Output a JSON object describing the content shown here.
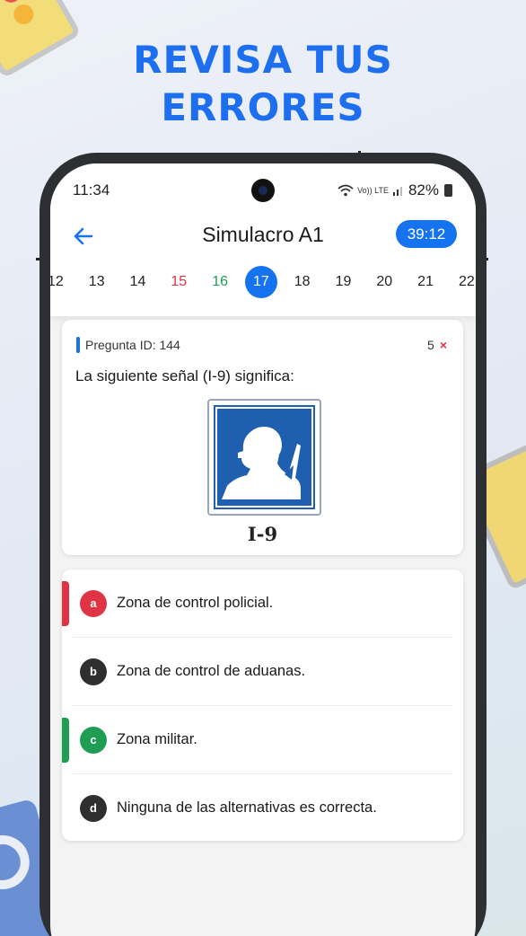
{
  "headline": [
    "REVISA TUS",
    "ERRORES"
  ],
  "status": {
    "time": "11:34",
    "network_label": "Vo)) LTE",
    "battery": "82%"
  },
  "header": {
    "title": "Simulacro A1",
    "timer": "39:12"
  },
  "question_numbers": [
    {
      "n": "12",
      "state": "normal"
    },
    {
      "n": "13",
      "state": "normal"
    },
    {
      "n": "14",
      "state": "normal"
    },
    {
      "n": "15",
      "state": "wrong"
    },
    {
      "n": "16",
      "state": "correct"
    },
    {
      "n": "17",
      "state": "active"
    },
    {
      "n": "18",
      "state": "normal"
    },
    {
      "n": "19",
      "state": "normal"
    },
    {
      "n": "20",
      "state": "normal"
    },
    {
      "n": "21",
      "state": "normal"
    },
    {
      "n": "22",
      "state": "normal"
    }
  ],
  "question": {
    "id_label": "Pregunta ID: 144",
    "error_count": "5",
    "error_mark": "×",
    "text": "La siguiente señal (I-9) significa:",
    "sign_label": "I-9"
  },
  "answers": [
    {
      "letter": "a",
      "text": "Zona de control policial.",
      "state": "wrong"
    },
    {
      "letter": "b",
      "text": "Zona de control de aduanas.",
      "state": "neutral"
    },
    {
      "letter": "c",
      "text": "Zona militar.",
      "state": "correct"
    },
    {
      "letter": "d",
      "text": "Ninguna de las alternativas es correcta.",
      "state": "neutral"
    }
  ],
  "colors": {
    "accent": "#1673f0",
    "wrong": "#e03444",
    "correct": "#1f9d55",
    "neutral": "#2f2f2f",
    "sign_blue": "#1f5fb0"
  }
}
